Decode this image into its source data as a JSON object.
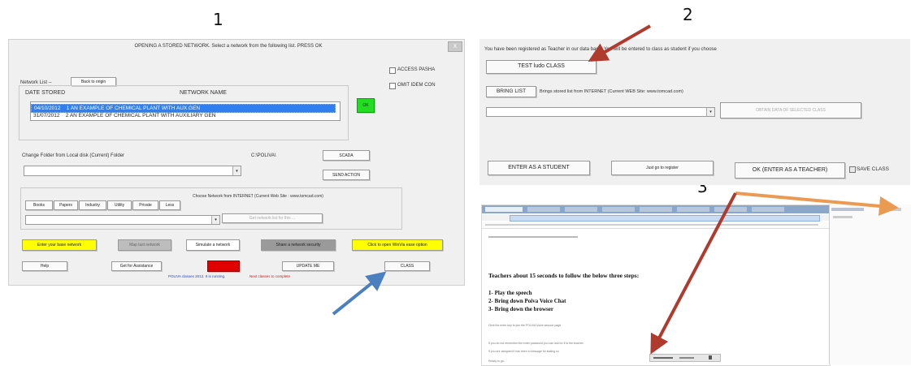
{
  "step_labels": [
    "1",
    "2",
    "3"
  ],
  "panel1": {
    "title": "OPENING A STORED NETWORK.   Select a network from the following list.   PRESS OK",
    "close_label": "X",
    "checkboxes": [
      "ACCESS PASHA",
      "OMIT IDEM CON"
    ],
    "network_list_label": "Network List --",
    "back_to_origin": "Back to origin",
    "col_date": "DATE STORED",
    "col_name": "NETWORK NAME",
    "rows": [
      {
        "date": "04/10/2012",
        "name": "1  AN EXAMPLE OF CHEMICAL PLANT WITH AUX.GEN",
        "selected": true
      },
      {
        "date": "31/07/2012",
        "name": "2  AN EXAMPLE OF CHEMICAL PLANT WITH AUXILIARY GEN",
        "selected": false
      }
    ],
    "ok_label": "OK",
    "change_folder_label": "Change Folder from Local disk  (Current) Folder",
    "folder_path": "C:\\POLIVA\\",
    "scada_label": "SCADA",
    "send_action_label": "SEND ACTION",
    "tabs": [
      "Books",
      "Papers",
      "Industry",
      "Utility",
      "Private",
      "Less"
    ],
    "internet_label": "Choose Network from INTERNET  (Current Web Site : www.tomcad.com)",
    "disabled_internet_btn": "Get network list for this ...",
    "action_buttons": [
      {
        "label": "Enter your base network",
        "color": "#ffff00"
      },
      {
        "label": "Map last network",
        "color": "#bdbdbd"
      },
      {
        "label": "Simulate a network",
        "color": "#ffffff"
      },
      {
        "label": "Share a network security",
        "color": "#9a9a9a"
      },
      {
        "label": "Click to open WinVia ease option",
        "color": "#ffff00"
      }
    ],
    "bottom_buttons": [
      "Help",
      "Get for Assistance",
      "",
      "UPDATE ME",
      "CLASS"
    ],
    "bottom_red_color": "#e00000",
    "status_blue": "POLIVA  classes 2012. It is running.",
    "status_red": "Next classes to complete"
  },
  "panel2": {
    "registered_text": "You have been registered as   Teacher in our data base.   You will be entered to class as student if you choose",
    "test_class": "TEST ludo CLASS",
    "bring_list": "BRING LIST",
    "bring_desc": "Brings stored list from INTERNET (Current WEB Site: www.tomcad.com)",
    "disabled_btn": "OBTAIN DATA OF SELECTED CLASS",
    "enter_student": "ENTER AS A STUDENT",
    "just_register": "Just go to register",
    "ok_teacher": "OK (ENTER AS A TEACHER)",
    "save_class": "SAVE CLASS"
  },
  "panel3": {
    "heading": "Teachers about 15 seconds to follow the below three steps:",
    "steps": [
      "1- Play the speech",
      "2- Bring down Poiva Voice Chat",
      "3- Bring down the browser"
    ],
    "note_1": "Click the enter key to join the POLIVA Voice session page",
    "note_2": "If you do not remember the enter password you can ask for it to the teacher",
    "note_3": "If you are assigned it has been a message for stating so",
    "note_4": "Ready to go."
  },
  "colors": {
    "arrow_red": "#b03a2e",
    "arrow_blue": "#4a7fc0",
    "arrow_orange": "#eb9a52",
    "selection_blue": "#2f7ff0",
    "ok_green": "#22dd22"
  }
}
